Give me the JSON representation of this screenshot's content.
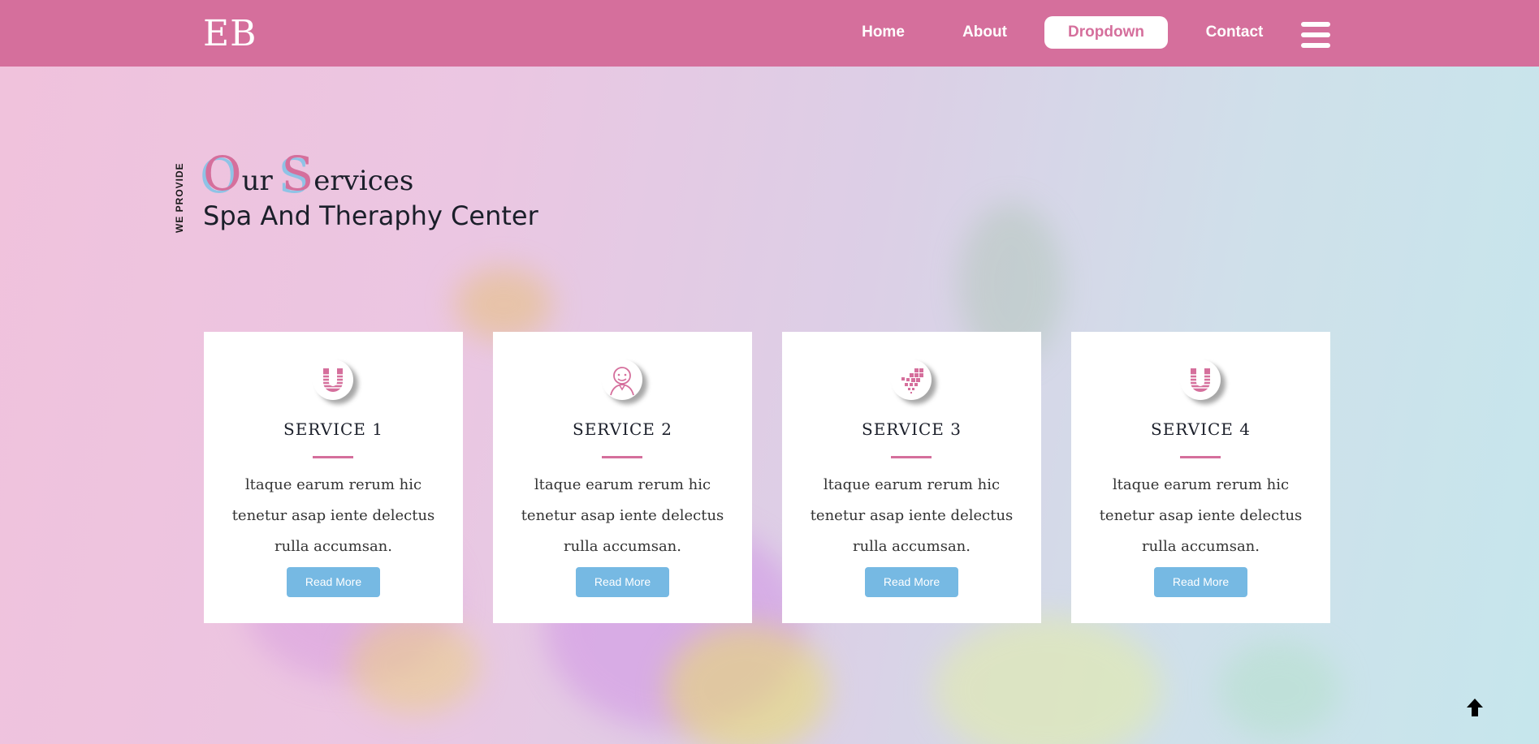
{
  "brand": {
    "logo": "EB"
  },
  "nav": {
    "items": [
      {
        "label": "Home"
      },
      {
        "label": "About"
      },
      {
        "label": "Dropdown"
      },
      {
        "label": "Contact"
      }
    ],
    "menu_icon": "hamburger-menu-icon"
  },
  "section": {
    "side_label": "WE PROVIDE",
    "title_big_o": "O",
    "title_rest_1": "ur ",
    "title_big_s": "S",
    "title_rest_2": "ervices",
    "subtitle": "Spa And Theraphy Center"
  },
  "services": [
    {
      "icon": "letter-u-icon",
      "title": "SERVICE 1",
      "text": "ltaque earum rerum hic tenetur asap iente delectus rulla accumsan.",
      "button": "Read More"
    },
    {
      "icon": "jenkins-face-icon",
      "title": "SERVICE 2",
      "text": "ltaque earum rerum hic tenetur asap iente delectus rulla accumsan.",
      "button": "Read More"
    },
    {
      "icon": "pixel-dots-icon",
      "title": "SERVICE 3",
      "text": "ltaque earum rerum hic tenetur asap iente delectus rulla accumsan.",
      "button": "Read More"
    },
    {
      "icon": "letter-u-icon",
      "title": "SERVICE 4",
      "text": "ltaque earum rerum hic tenetur asap iente delectus rulla accumsan.",
      "button": "Read More"
    }
  ],
  "back_to_top_icon": "arrow-up-icon",
  "colors": {
    "accent_pink": "#d56f9c",
    "button_blue": "#76b9e3",
    "shadow_blue": "#8fc3e6",
    "card_bg": "#ffffff"
  }
}
